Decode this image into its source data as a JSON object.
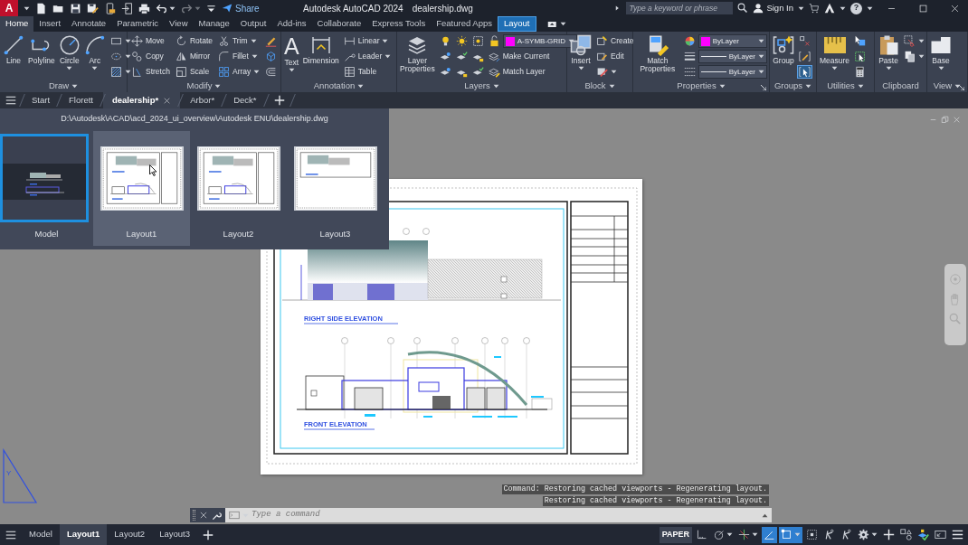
{
  "title_bar": {
    "logo_glyph": "A",
    "quick_access": [
      {
        "dropdown": false,
        "disabled": false
      },
      {
        "dropdown": false,
        "disabled": false
      },
      {
        "dropdown": false,
        "disabled": false
      },
      {
        "dropdown": false,
        "disabled": false
      },
      {
        "dropdown": false,
        "disabled": false
      },
      {
        "dropdown": false,
        "disabled": false
      },
      {
        "dropdown": false,
        "disabled": false
      },
      {
        "dropdown": true,
        "disabled": false
      },
      {
        "dropdown": true,
        "disabled": true
      }
    ],
    "share": "Share",
    "app_title": "Autodesk AutoCAD 2024",
    "file_name": "dealership.dwg",
    "search": {
      "placeholder": "Type a keyword or phrase"
    },
    "sign_in": "Sign In",
    "help_glyph": "?"
  },
  "ribbon_tabs": [
    {
      "label": "Home",
      "selected": true,
      "kind": "standard"
    },
    {
      "label": "Insert",
      "selected": false,
      "kind": "standard"
    },
    {
      "label": "Annotate",
      "selected": false,
      "kind": "standard"
    },
    {
      "label": "Parametric",
      "selected": false,
      "kind": "standard"
    },
    {
      "label": "View",
      "selected": false,
      "kind": "standard"
    },
    {
      "label": "Manage",
      "selected": false,
      "kind": "standard"
    },
    {
      "label": "Output",
      "selected": false,
      "kind": "standard"
    },
    {
      "label": "Add-ins",
      "selected": false,
      "kind": "standard"
    },
    {
      "label": "Collaborate",
      "selected": false,
      "kind": "standard"
    },
    {
      "label": "Express Tools",
      "selected": false,
      "kind": "standard"
    },
    {
      "label": "Featured Apps",
      "selected": false,
      "kind": "standard"
    },
    {
      "label": "Layout",
      "selected": false,
      "kind": "contextual"
    }
  ],
  "ribbon_panels": [
    {
      "title": "Draw",
      "dropdown": true,
      "launcher": false,
      "columns": [
        {
          "kind": "large",
          "label": "Line",
          "dropdown": false
        },
        {
          "kind": "large",
          "label": "Polyline",
          "dropdown": false
        },
        {
          "kind": "large",
          "label": "Circle",
          "dropdown": true
        },
        {
          "kind": "large",
          "label": "Arc",
          "dropdown": true
        },
        {
          "kind": "stack",
          "rows": [
            [
              {
                "kind": "tool",
                "dropdown": true
              }
            ],
            [
              {
                "kind": "tool",
                "dropdown": true
              }
            ],
            [
              {
                "kind": "tool",
                "dropdown": true
              }
            ]
          ]
        }
      ]
    },
    {
      "title": "Modify",
      "dropdown": true,
      "launcher": false,
      "columns": [
        {
          "kind": "stack",
          "rows": [
            [
              {
                "kind": "tool",
                "label": "Move",
                "dropdown": false
              }
            ],
            [
              {
                "kind": "tool",
                "label": "Copy",
                "dropdown": false
              }
            ],
            [
              {
                "kind": "tool",
                "label": "Stretch",
                "dropdown": false
              }
            ]
          ]
        },
        {
          "kind": "stack",
          "rows": [
            [
              {
                "kind": "tool",
                "label": "Rotate",
                "dropdown": false
              }
            ],
            [
              {
                "kind": "tool",
                "label": "Mirror",
                "dropdown": false
              }
            ],
            [
              {
                "kind": "tool",
                "label": "Scale",
                "dropdown": false
              }
            ]
          ]
        },
        {
          "kind": "stack",
          "rows": [
            [
              {
                "kind": "tool",
                "label": "Trim",
                "dropdown": true
              }
            ],
            [
              {
                "kind": "tool",
                "label": "Fillet",
                "dropdown": true
              }
            ],
            [
              {
                "kind": "tool",
                "label": "Array",
                "dropdown": true
              }
            ]
          ]
        },
        {
          "kind": "stack",
          "rows": [
            [
              {
                "kind": "tool",
                "dropdown": false
              }
            ],
            [
              {
                "kind": "tool",
                "dropdown": false
              }
            ],
            [
              {
                "kind": "tool",
                "dropdown": false
              }
            ]
          ]
        }
      ]
    },
    {
      "title": "Annotation",
      "dropdown": true,
      "launcher": false,
      "columns": [
        {
          "kind": "large",
          "label": "Text",
          "glyph": "A",
          "dropdown": true
        },
        {
          "kind": "large",
          "label": "Dimension",
          "dropdown": false
        },
        {
          "kind": "stack",
          "rows": [
            [
              {
                "kind": "tool",
                "label": "Linear",
                "dropdown": true
              }
            ],
            [
              {
                "kind": "tool",
                "label": "Leader",
                "dropdown": true
              }
            ],
            [
              {
                "kind": "tool",
                "label": "Table",
                "dropdown": false
              }
            ]
          ]
        }
      ]
    },
    {
      "title": "Layers",
      "dropdown": true,
      "launcher": false,
      "columns": [
        {
          "kind": "large",
          "label": "Layer Properties",
          "dropdown": false
        },
        {
          "kind": "stack",
          "rows": [
            [
              {
                "kind": "tool",
                "dropdown": false
              },
              {
                "kind": "tool",
                "dropdown": false
              },
              {
                "kind": "tool",
                "dropdown": false
              },
              {
                "kind": "tool",
                "dropdown": false
              },
              {
                "kind": "combo",
                "value": "A-SYMB-GRID",
                "color": "#ff00ff",
                "dropdown": true
              }
            ],
            [
              {
                "kind": "tool",
                "dropdown": false
              },
              {
                "kind": "tool",
                "dropdown": false
              },
              {
                "kind": "tool",
                "dropdown": false
              },
              {
                "kind": "tool",
                "label": "Make Current",
                "dropdown": false
              }
            ],
            [
              {
                "kind": "tool",
                "dropdown": false
              },
              {
                "kind": "tool",
                "dropdown": false
              },
              {
                "kind": "tool",
                "dropdown": false
              },
              {
                "kind": "tool",
                "label": "Match Layer",
                "dropdown": false
              }
            ]
          ]
        }
      ]
    },
    {
      "title": "Block",
      "dropdown": true,
      "launcher": false,
      "columns": [
        {
          "kind": "large",
          "label": "Insert",
          "dropdown": true
        },
        {
          "kind": "stack",
          "rows": [
            [
              {
                "kind": "tool",
                "label": "Create",
                "dropdown": false
              }
            ],
            [
              {
                "kind": "tool",
                "label": "Edit",
                "dropdown": false
              }
            ],
            [
              {
                "kind": "tool",
                "dropdown": true
              }
            ]
          ]
        }
      ]
    },
    {
      "title": "Properties",
      "dropdown": true,
      "launcher": true,
      "columns": [
        {
          "kind": "large",
          "label": "Match Properties",
          "dropdown": false
        },
        {
          "kind": "stack",
          "rows": [
            [
              {
                "kind": "tool",
                "dropdown": false
              },
              {
                "kind": "combo",
                "value": "ByLayer",
                "color": "#ff00ff",
                "dropdown": true
              }
            ],
            [
              {
                "kind": "tool",
                "dropdown": false
              },
              {
                "kind": "combo",
                "value": "ByLayer",
                "line": true,
                "dropdown": true
              }
            ],
            [
              {
                "kind": "tool",
                "dropdown": false
              },
              {
                "kind": "combo",
                "value": "ByLayer",
                "line": true,
                "dropdown": true
              }
            ]
          ]
        }
      ]
    },
    {
      "title": "Groups",
      "dropdown": true,
      "launcher": false,
      "columns": [
        {
          "kind": "large",
          "label": "Group",
          "dropdown": false
        },
        {
          "kind": "stack",
          "rows": [
            [
              {
                "kind": "tool",
                "dropdown": false,
                "active": false
              }
            ],
            [
              {
                "kind": "tool",
                "dropdown": false,
                "active": false
              }
            ],
            [
              {
                "kind": "tool",
                "dropdown": false,
                "active": true
              }
            ]
          ]
        }
      ]
    },
    {
      "title": "Utilities",
      "dropdown": true,
      "launcher": false,
      "columns": [
        {
          "kind": "large",
          "label": "Measure",
          "dropdown": true
        },
        {
          "kind": "stack",
          "rows": [
            [
              {
                "kind": "tool",
                "dropdown": false
              }
            ],
            [
              {
                "kind": "tool",
                "dropdown": false
              }
            ],
            [
              {
                "kind": "tool",
                "dropdown": false
              }
            ]
          ]
        }
      ]
    },
    {
      "title": "Clipboard",
      "dropdown": false,
      "launcher": false,
      "columns": [
        {
          "kind": "large",
          "label": "Paste",
          "dropdown": true
        },
        {
          "kind": "stack",
          "rows": [
            [
              {
                "kind": "tool",
                "dropdown": true
              }
            ],
            [
              {
                "kind": "tool",
                "dropdown": true
              }
            ]
          ]
        }
      ]
    },
    {
      "title": "View",
      "dropdown": true,
      "launcher": true,
      "columns": [
        {
          "kind": "large",
          "label": "Base",
          "dropdown": true
        }
      ]
    }
  ],
  "file_tabs": [
    {
      "label": "Start",
      "selected": false,
      "closable": false
    },
    {
      "label": "Florett",
      "selected": false,
      "closable": false
    },
    {
      "label": "dealership*",
      "selected": true,
      "closable": true
    },
    {
      "label": "Arbor*",
      "selected": false,
      "closable": false
    },
    {
      "label": "Deck*",
      "selected": false,
      "closable": false
    }
  ],
  "layout_preview": {
    "path": "D:\\Autodesk\\ACAD\\acd_2024_ui_overview\\Autodesk ENU\\dealership.dwg",
    "items": [
      {
        "label": "Model",
        "kind": "model",
        "selected": true,
        "hovered": false
      },
      {
        "label": "Layout1",
        "kind": "full",
        "selected": false,
        "hovered": true
      },
      {
        "label": "Layout2",
        "kind": "full",
        "selected": false,
        "hovered": false
      },
      {
        "label": "Layout3",
        "kind": "partial",
        "selected": false,
        "hovered": false
      }
    ]
  },
  "sheet": {
    "views": [
      {
        "label": "RIGHT SIDE ELEVATION",
        "kind": "side"
      },
      {
        "label": "FRONT ELEVATION",
        "kind": "front"
      }
    ]
  },
  "ucs": {
    "axis_label": "Y"
  },
  "command_line": {
    "history": [
      "Command: Restoring cached viewports - Regenerating layout.",
      "Restoring cached viewports - Regenerating layout."
    ],
    "placeholder": "Type a command"
  },
  "layout_tabs": [
    {
      "label": "Model",
      "selected": false
    },
    {
      "label": "Layout1",
      "selected": true
    },
    {
      "label": "Layout2",
      "selected": false
    },
    {
      "label": "Layout3",
      "selected": false
    }
  ],
  "status_tools": [
    {
      "kind": "text",
      "label": "PAPER",
      "on": false,
      "dropdown": false
    },
    {
      "kind": "icon",
      "on": false,
      "dropdown": false
    },
    {
      "kind": "icon",
      "on": false,
      "dropdown": true
    },
    {
      "kind": "icon",
      "on": false,
      "dropdown": true
    },
    {
      "kind": "icon",
      "on": true,
      "dropdown": false
    },
    {
      "kind": "icon",
      "on": true,
      "dropdown": true
    },
    {
      "kind": "icon",
      "on": false,
      "dropdown": false
    },
    {
      "kind": "icon",
      "on": false,
      "dropdown": false
    },
    {
      "kind": "icon",
      "on": false,
      "dropdown": false
    },
    {
      "kind": "icon",
      "on": false,
      "dropdown": true
    },
    {
      "kind": "icon",
      "on": false,
      "dropdown": false
    },
    {
      "kind": "icon",
      "on": false,
      "dropdown": false
    },
    {
      "kind": "icon",
      "on": false,
      "dropdown": false
    },
    {
      "kind": "icon",
      "on": false,
      "dropdown": false
    },
    {
      "kind": "icon",
      "on": false,
      "dropdown": false
    }
  ]
}
